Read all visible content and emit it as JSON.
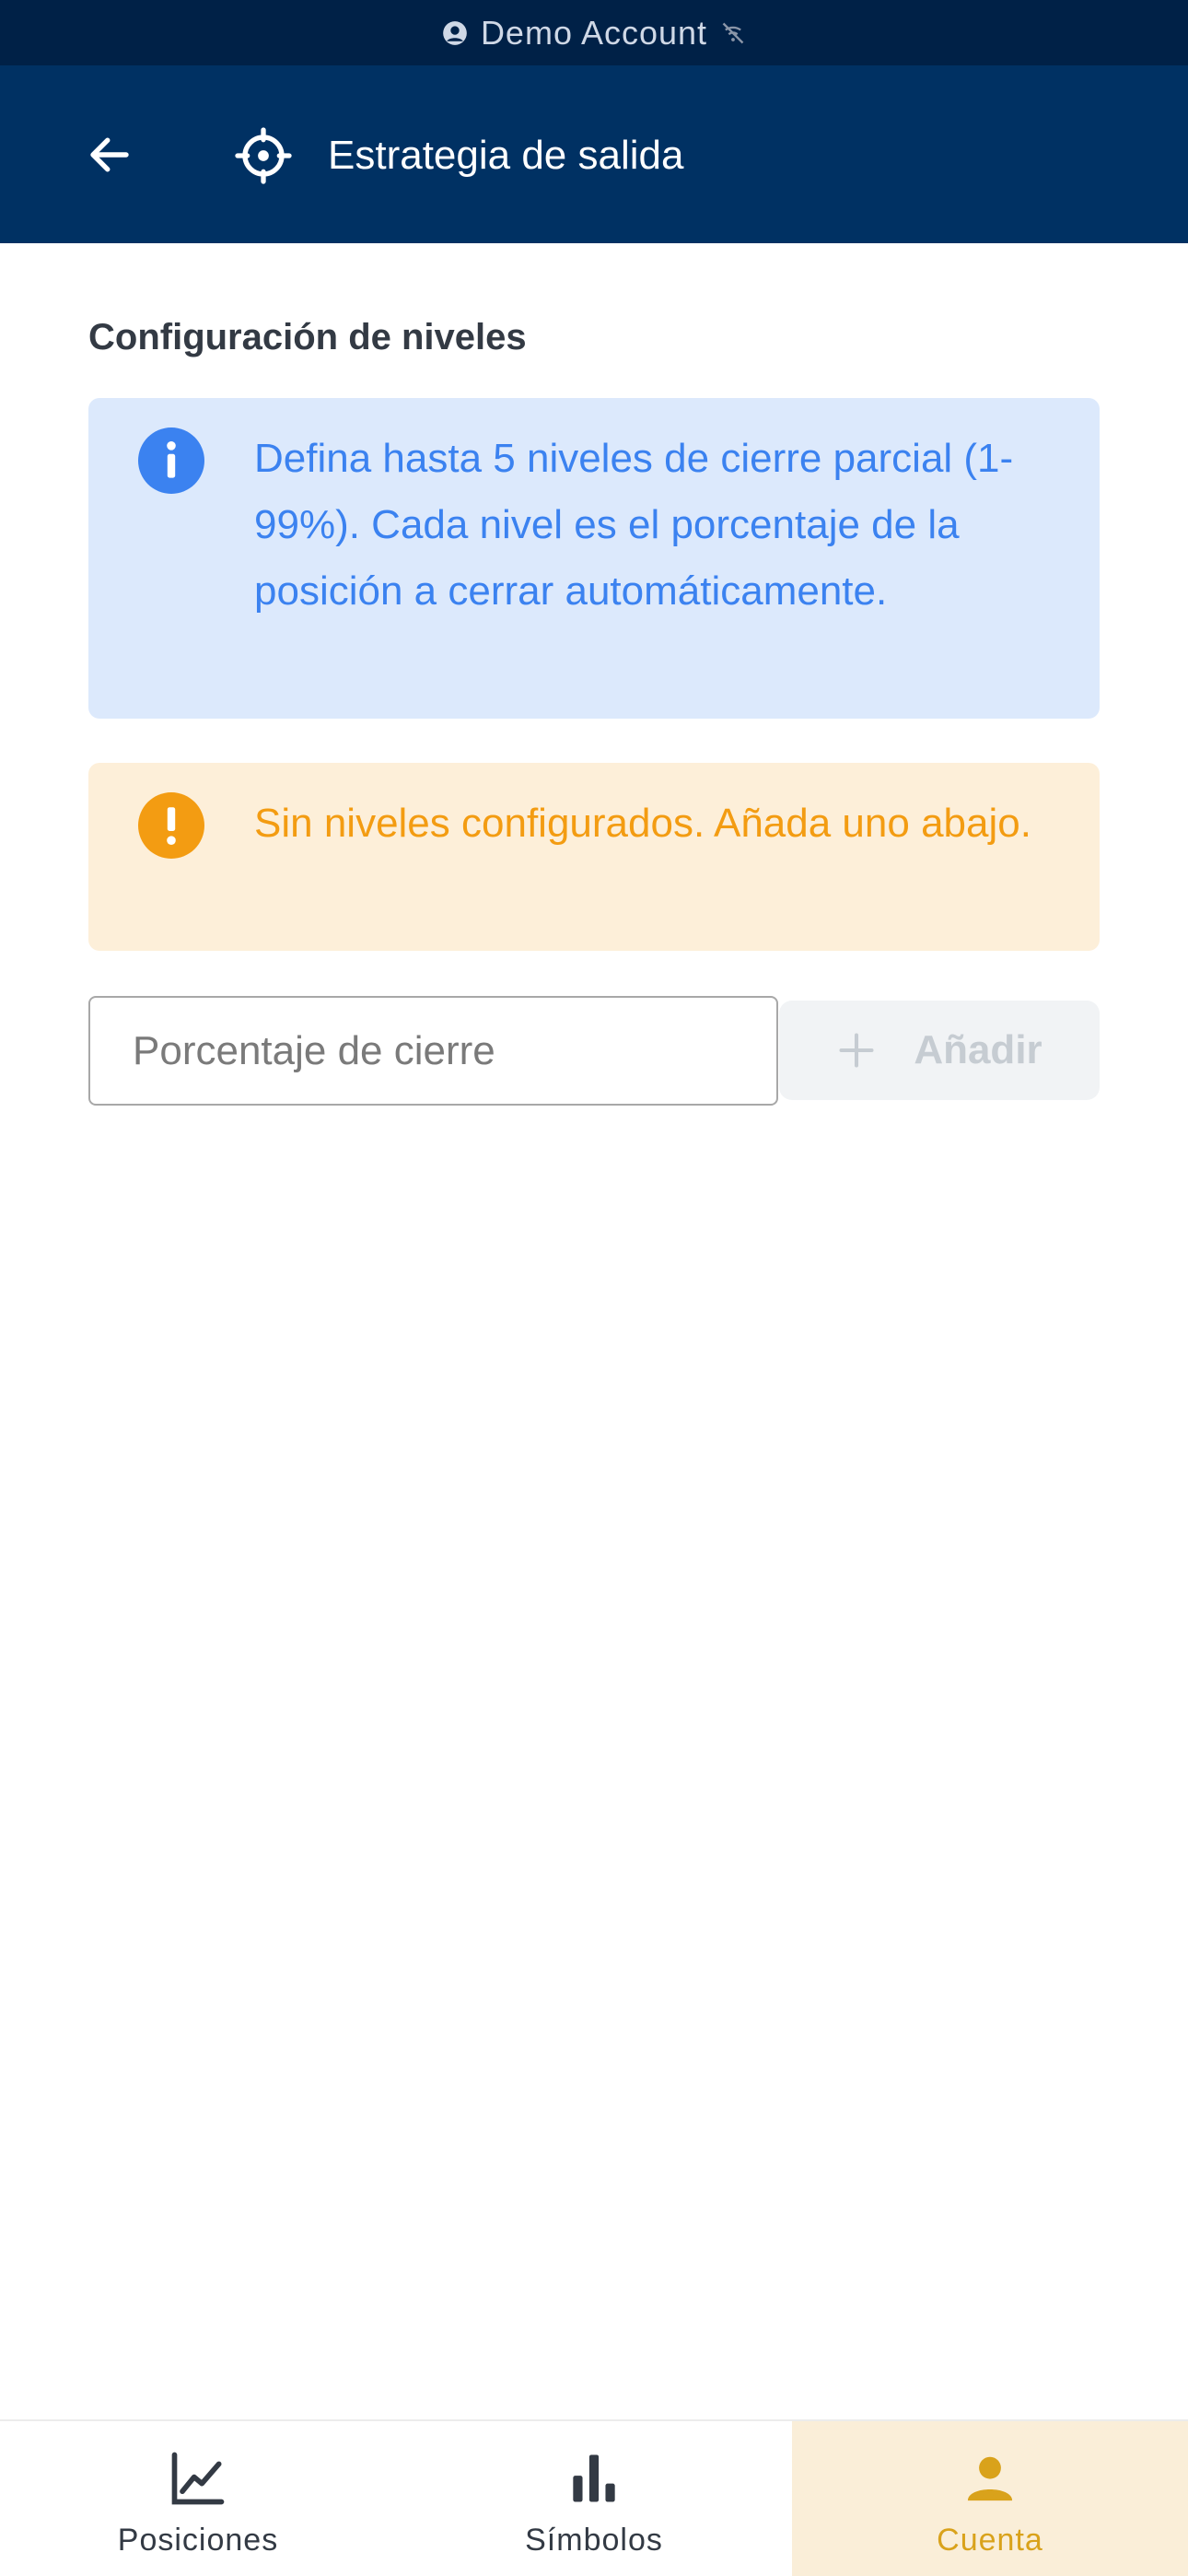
{
  "status_bar": {
    "account_label": "Demo Account",
    "icons": [
      "account-circle-icon",
      "wifi-off-icon"
    ]
  },
  "header": {
    "title": "Estrategia de salida",
    "back_icon": "arrow-left-icon",
    "title_icon": "crosshair-icon"
  },
  "section": {
    "title": "Configuración de niveles"
  },
  "info_box": {
    "icon": "info-icon",
    "text": "Defina hasta 5 niveles de cierre parcial (1-99%). Cada nivel es el porcentaje de la posición a cerrar automáticamente."
  },
  "warning_box": {
    "icon": "warning-icon",
    "text": "Sin niveles configurados. Añada uno abajo."
  },
  "add_level": {
    "input_placeholder": "Porcentaje de cierre",
    "input_value": "",
    "button_label": "Añadir",
    "button_icon": "plus-icon",
    "button_enabled": false
  },
  "bottom_nav": {
    "items": [
      {
        "label": "Posiciones",
        "icon": "line-chart-icon",
        "active": false
      },
      {
        "label": "Símbolos",
        "icon": "bar-chart-icon",
        "active": false
      },
      {
        "label": "Cuenta",
        "icon": "person-icon",
        "active": true
      }
    ]
  },
  "colors": {
    "status_bar": "#002147",
    "app_bar": "#003163",
    "info_bg": "#dce9fc",
    "info_fg": "#3b82f0",
    "warning_bg": "#fdefd9",
    "warning_fg": "#f39c12",
    "active_nav_bg": "#faeed8",
    "active_nav_fg": "#d9a21b"
  }
}
